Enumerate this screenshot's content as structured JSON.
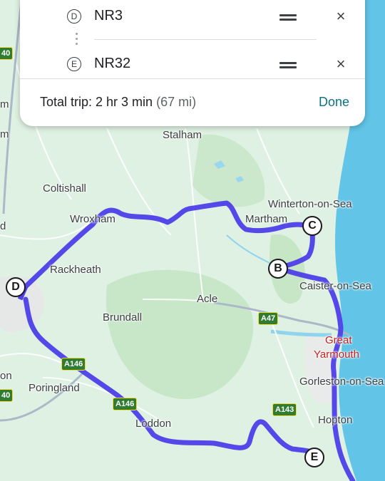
{
  "stops": [
    {
      "letter": "D",
      "name": "NR3"
    },
    {
      "letter": "E",
      "name": "NR32"
    }
  ],
  "trip": {
    "prefix": "Total trip: ",
    "duration": "2 hr 3 min",
    "distance": "(67 mi)",
    "done_label": "Done"
  },
  "map": {
    "places": [
      {
        "id": "stalham",
        "name": "Stalham"
      },
      {
        "id": "coltishall",
        "name": "Coltishall"
      },
      {
        "id": "wroxham",
        "name": "Wroxham"
      },
      {
        "id": "winterton",
        "name": "Winterton-on-Sea"
      },
      {
        "id": "martham",
        "name": "Martham"
      },
      {
        "id": "rackheath",
        "name": "Rackheath"
      },
      {
        "id": "caister",
        "name": "Caister-on-Sea"
      },
      {
        "id": "acle",
        "name": "Acle"
      },
      {
        "id": "brundall",
        "name": "Brundall"
      },
      {
        "id": "great",
        "name": "Great"
      },
      {
        "id": "yarmouth",
        "name": "Yarmouth"
      },
      {
        "id": "gorleston",
        "name": "Gorleston-on-Sea"
      },
      {
        "id": "poringland",
        "name": "Poringland"
      },
      {
        "id": "loddon",
        "name": "Loddon"
      },
      {
        "id": "hopton",
        "name": "Hopton"
      }
    ],
    "roads": [
      "A47",
      "A146",
      "A146",
      "A143",
      "40",
      "40"
    ],
    "edge_text": [
      "m",
      "m",
      "d",
      "on"
    ],
    "markers": [
      "B",
      "C",
      "D",
      "E"
    ],
    "colors": {
      "land": "#dff1e2",
      "water": "#62c4e6",
      "route": "#4d3ee8",
      "road_shield": "#2e7d32"
    }
  }
}
